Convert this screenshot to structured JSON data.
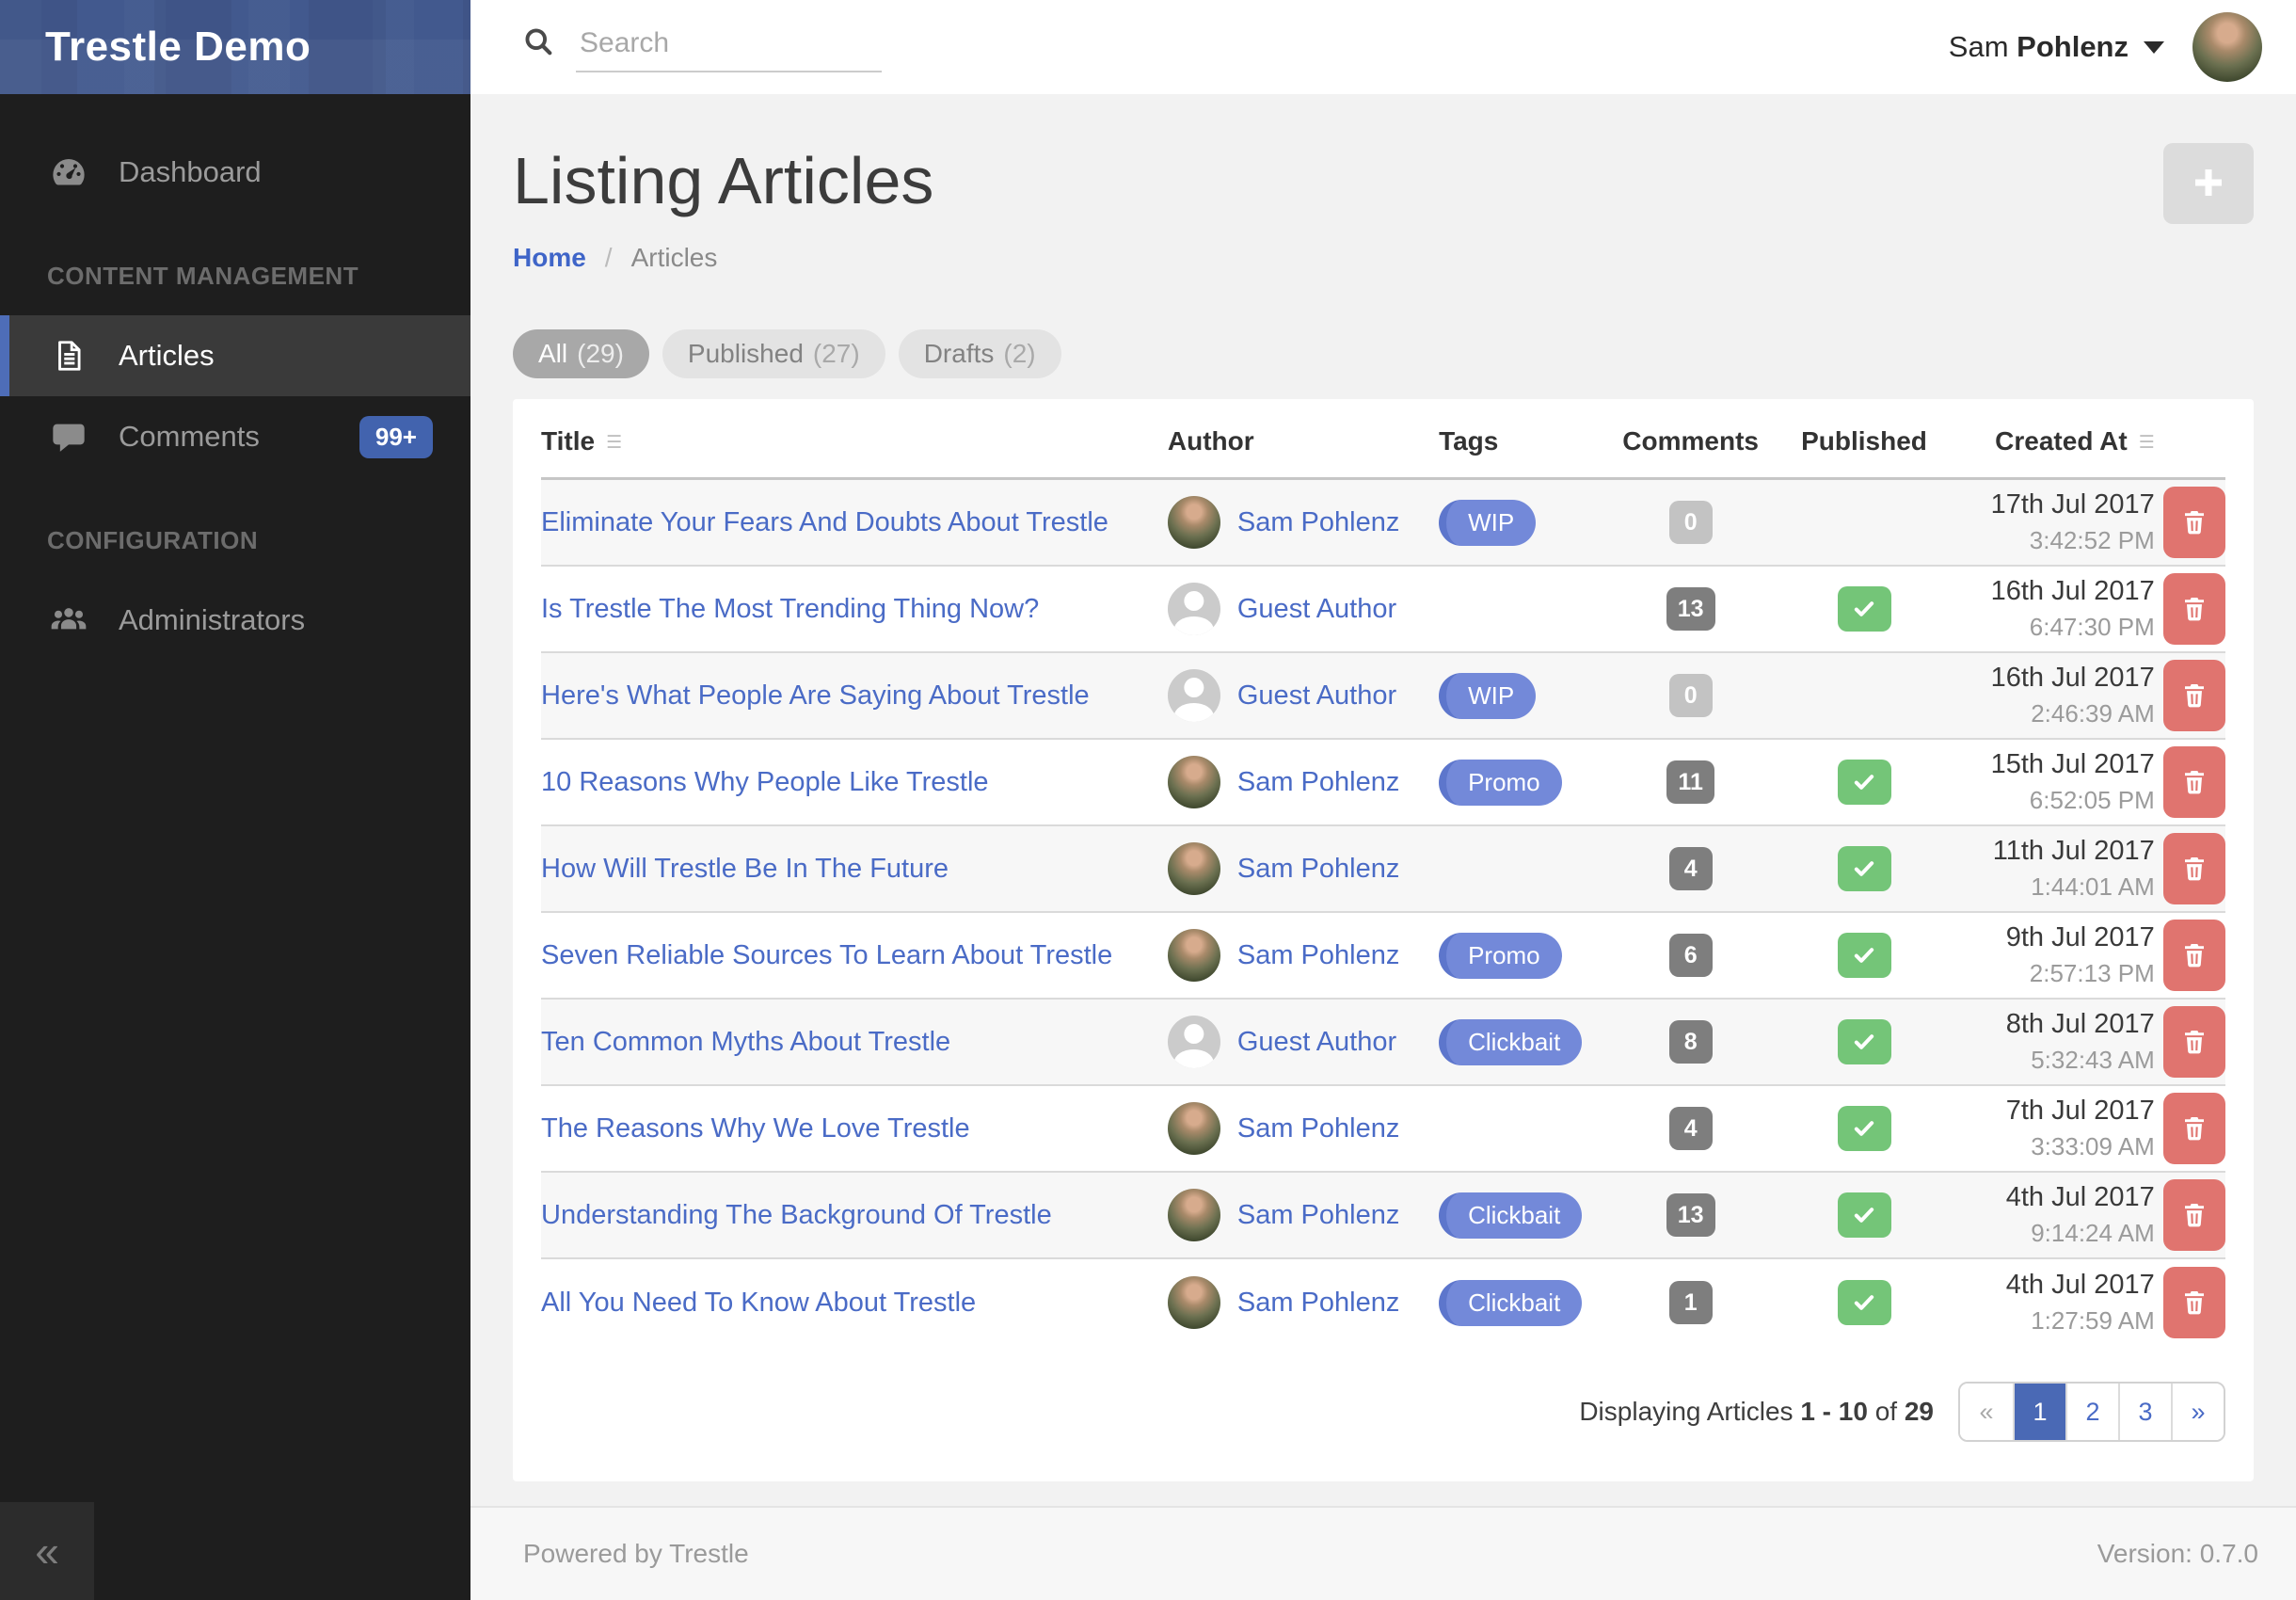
{
  "colors": {
    "brand_header": "#42598e",
    "sidebar_bg": "#1e1e1e",
    "sidebar_active_border": "#4e6db8",
    "accent_blue": "#4a69b5",
    "link_blue": "#4a6bc6",
    "tag_blue": "#7389d9",
    "success_green": "#74c578",
    "danger_red": "#e0746f",
    "badge_gray": "#7e7e7e",
    "badge_muted": "#c3c3c3"
  },
  "sidebar": {
    "brand": "Trestle Demo",
    "items": [
      {
        "icon": "gauge-icon",
        "label": "Dashboard"
      },
      {
        "icon": "document-icon",
        "label": "Articles",
        "active": true
      },
      {
        "icon": "comment-icon",
        "label": "Comments",
        "badge": "99+"
      },
      {
        "icon": "users-icon",
        "label": "Administrators"
      }
    ],
    "sections": [
      {
        "label": "CONTENT MANAGEMENT"
      },
      {
        "label": "CONFIGURATION"
      }
    ],
    "collapse_icon": "«"
  },
  "topbar": {
    "search_placeholder": "Search",
    "user_first": "Sam",
    "user_last": "Pohlenz"
  },
  "page": {
    "title": "Listing Articles",
    "breadcrumb": {
      "home": "Home",
      "separator": "/",
      "current": "Articles"
    }
  },
  "tabs": [
    {
      "label": "All",
      "count": "(29)",
      "active": true
    },
    {
      "label": "Published",
      "count": "(27)",
      "active": false
    },
    {
      "label": "Drafts",
      "count": "(2)",
      "active": false
    }
  ],
  "table": {
    "headers": {
      "title": "Title",
      "author": "Author",
      "tags": "Tags",
      "comments": "Comments",
      "published": "Published",
      "created_at": "Created At"
    },
    "sort_icon": "☰",
    "rows": [
      {
        "title": "Eliminate Your Fears And Doubts About Trestle",
        "author": "Sam Pohlenz",
        "avatar": "photo",
        "tag": "WIP",
        "comments": "0",
        "comments_muted": true,
        "published": false,
        "date": "17th Jul 2017",
        "time": "3:42:52 PM"
      },
      {
        "title": "Is Trestle The Most Trending Thing Now?",
        "author": "Guest Author",
        "avatar": "guest",
        "tag": null,
        "comments": "13",
        "comments_muted": false,
        "published": true,
        "date": "16th Jul 2017",
        "time": "6:47:30 PM"
      },
      {
        "title": "Here's What People Are Saying About Trestle",
        "author": "Guest Author",
        "avatar": "guest",
        "tag": "WIP",
        "comments": "0",
        "comments_muted": true,
        "published": false,
        "date": "16th Jul 2017",
        "time": "2:46:39 AM"
      },
      {
        "title": "10 Reasons Why People Like Trestle",
        "author": "Sam Pohlenz",
        "avatar": "photo",
        "tag": "Promo",
        "comments": "11",
        "comments_muted": false,
        "published": true,
        "date": "15th Jul 2017",
        "time": "6:52:05 PM"
      },
      {
        "title": "How Will Trestle Be In The Future",
        "author": "Sam Pohlenz",
        "avatar": "photo",
        "tag": null,
        "comments": "4",
        "comments_muted": false,
        "published": true,
        "date": "11th Jul 2017",
        "time": "1:44:01 AM"
      },
      {
        "title": "Seven Reliable Sources To Learn About Trestle",
        "author": "Sam Pohlenz",
        "avatar": "photo",
        "tag": "Promo",
        "comments": "6",
        "comments_muted": false,
        "published": true,
        "date": "9th Jul 2017",
        "time": "2:57:13 PM"
      },
      {
        "title": "Ten Common Myths About Trestle",
        "author": "Guest Author",
        "avatar": "guest",
        "tag": "Clickbait",
        "comments": "8",
        "comments_muted": false,
        "published": true,
        "date": "8th Jul 2017",
        "time": "5:32:43 AM"
      },
      {
        "title": "The Reasons Why We Love Trestle",
        "author": "Sam Pohlenz",
        "avatar": "photo",
        "tag": null,
        "comments": "4",
        "comments_muted": false,
        "published": true,
        "date": "7th Jul 2017",
        "time": "3:33:09 AM"
      },
      {
        "title": "Understanding The Background Of Trestle",
        "author": "Sam Pohlenz",
        "avatar": "photo",
        "tag": "Clickbait",
        "comments": "13",
        "comments_muted": false,
        "published": true,
        "date": "4th Jul 2017",
        "time": "9:14:24 AM"
      },
      {
        "title": "All You Need To Know About Trestle",
        "author": "Sam Pohlenz",
        "avatar": "photo",
        "tag": "Clickbait",
        "comments": "1",
        "comments_muted": false,
        "published": true,
        "date": "4th Jul 2017",
        "time": "1:27:59 AM"
      }
    ]
  },
  "pagination": {
    "summary_prefix": "Displaying Articles ",
    "range": "1 - 10",
    "of": " of ",
    "total": "29",
    "pages": [
      {
        "label": "«",
        "kind": "prev",
        "disabled": true
      },
      {
        "label": "1",
        "kind": "page",
        "active": true
      },
      {
        "label": "2",
        "kind": "page"
      },
      {
        "label": "3",
        "kind": "page"
      },
      {
        "label": "»",
        "kind": "next"
      }
    ]
  },
  "footer": {
    "left": "Powered by Trestle",
    "right": "Version: 0.7.0"
  }
}
